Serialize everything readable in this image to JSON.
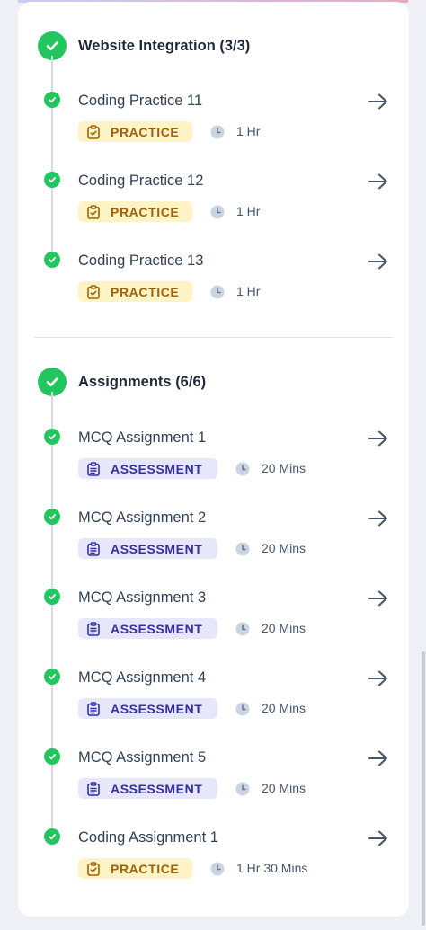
{
  "sections": [
    {
      "title": "Website Integration (3/3)",
      "items": [
        {
          "title": "Coding Practice 11",
          "tag": "PRACTICE",
          "duration": "1 Hr"
        },
        {
          "title": "Coding Practice 12",
          "tag": "PRACTICE",
          "duration": "1 Hr"
        },
        {
          "title": "Coding Practice 13",
          "tag": "PRACTICE",
          "duration": "1 Hr"
        }
      ]
    },
    {
      "title": "Assignments (6/6)",
      "items": [
        {
          "title": "MCQ Assignment 1",
          "tag": "ASSESSMENT",
          "duration": "20 Mins"
        },
        {
          "title": "MCQ Assignment 2",
          "tag": "ASSESSMENT",
          "duration": "20 Mins"
        },
        {
          "title": "MCQ Assignment 3",
          "tag": "ASSESSMENT",
          "duration": "20 Mins"
        },
        {
          "title": "MCQ Assignment 4",
          "tag": "ASSESSMENT",
          "duration": "20 Mins"
        },
        {
          "title": "MCQ Assignment 5",
          "tag": "ASSESSMENT",
          "duration": "20 Mins"
        },
        {
          "title": "Coding Assignment 1",
          "tag": "PRACTICE",
          "duration": "1 Hr 30 Mins"
        }
      ]
    }
  ],
  "colors": {
    "complete_green": "#22c55e",
    "practice_bg": "#fdf3c4",
    "practice_text": "#a16207",
    "assessment_bg": "#e6e7fb",
    "assessment_text": "#3730a3"
  },
  "icons": {
    "status": "check-circle-icon",
    "open": "arrow-right-icon",
    "practice": "clipboard-check-icon",
    "assessment": "clipboard-list-icon",
    "duration": "clock-icon"
  }
}
